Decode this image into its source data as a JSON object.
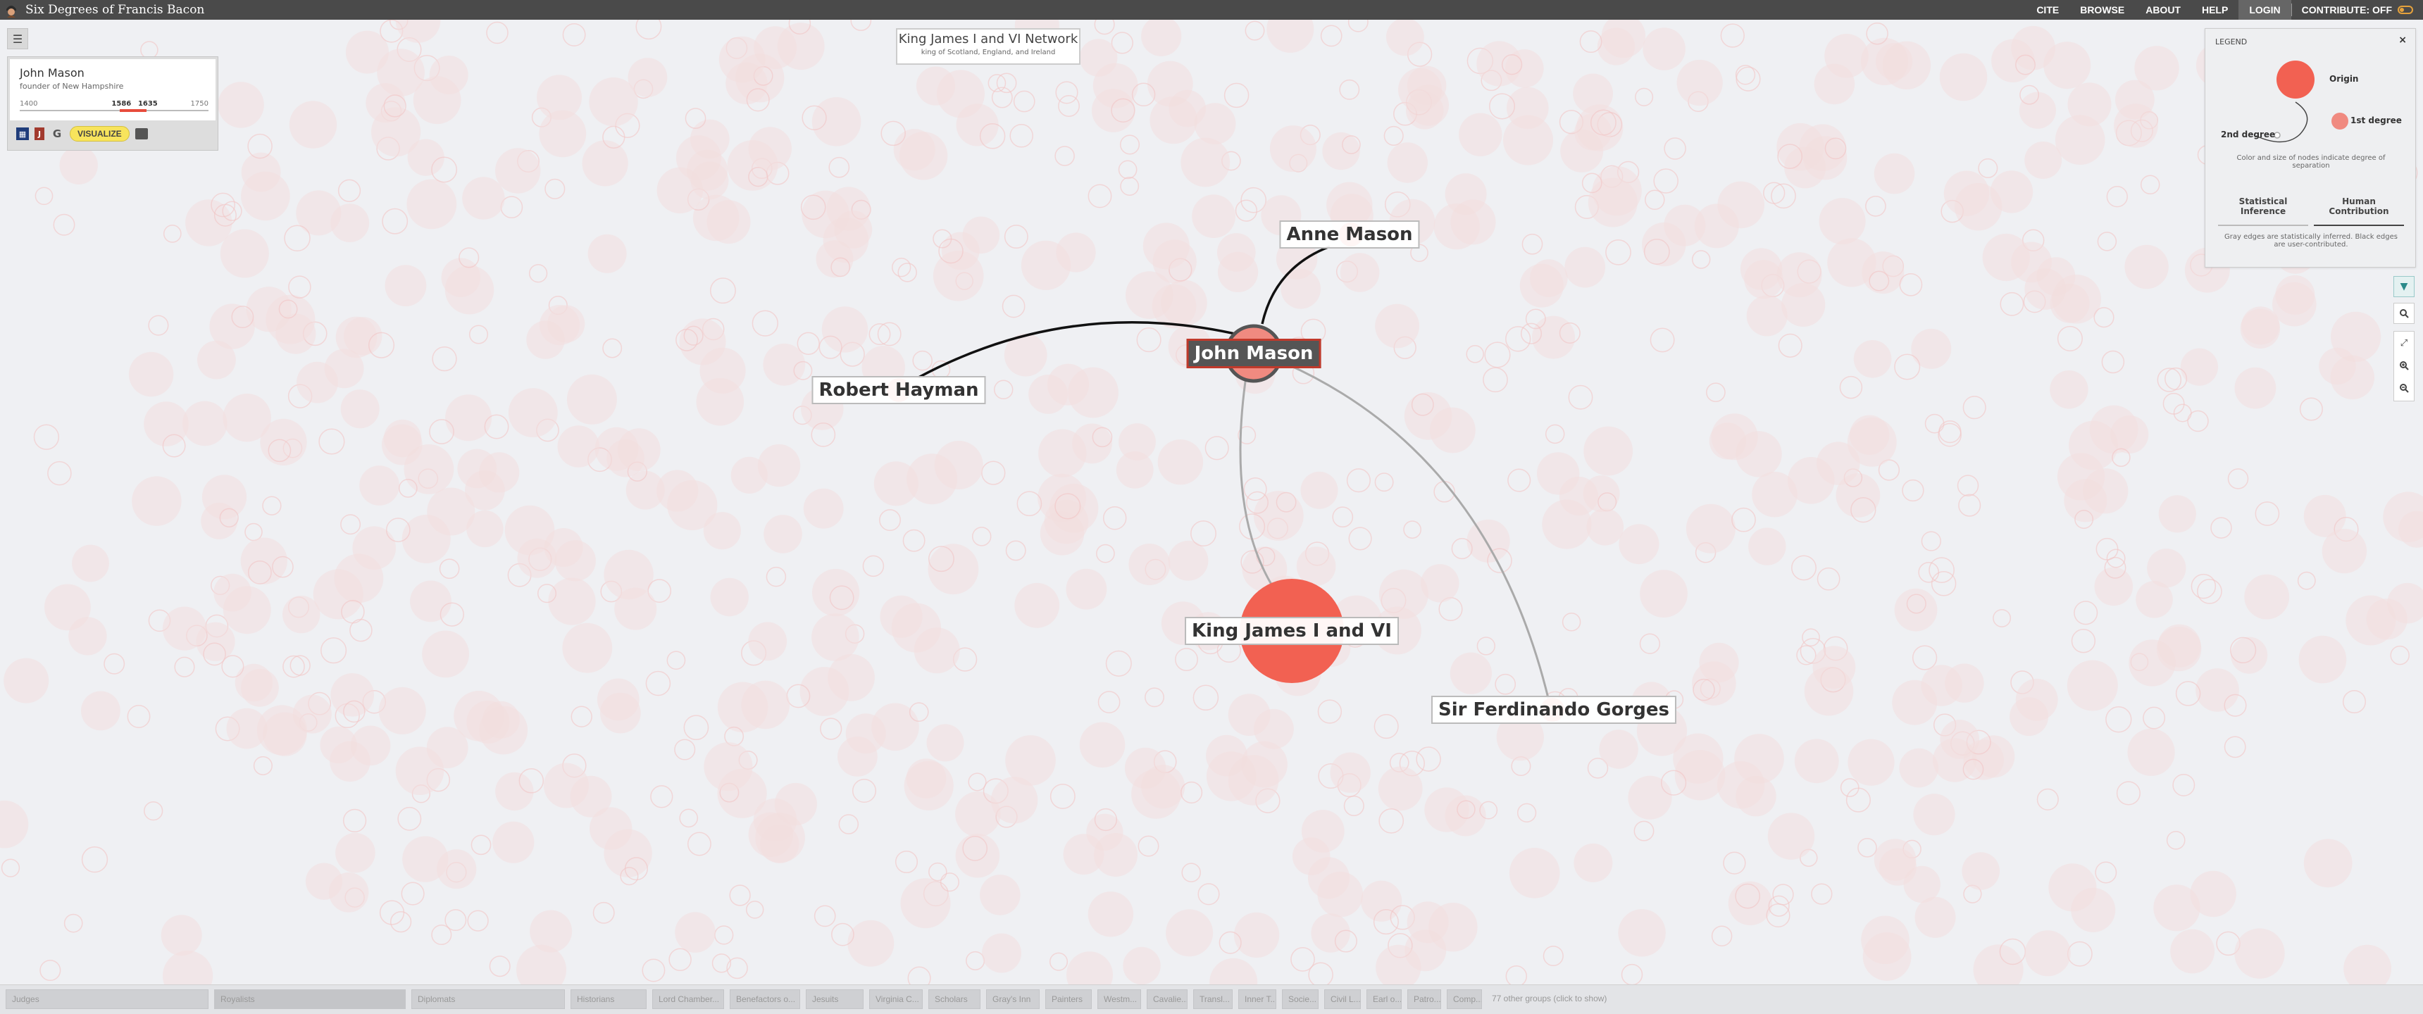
{
  "app": {
    "title": "Six Degrees of Francis Bacon"
  },
  "nav": {
    "cite": "CITE",
    "browse": "BROWSE",
    "about": "ABOUT",
    "help": "HELP",
    "login": "LOGIN",
    "contribute": "CONTRIBUTE: OFF"
  },
  "network": {
    "title": "King James I and VI Network",
    "subtitle": "king of Scotland, England, and Ireland"
  },
  "person_card": {
    "name": "John Mason",
    "description": "founder of New Hampshire",
    "timeline": {
      "min": "1400",
      "start": "1586",
      "end": "1635",
      "max": "1750",
      "min_value": 1400,
      "max_value": 1750,
      "start_value": 1586,
      "end_value": 1635
    },
    "visualize_label": "VISUALIZE",
    "sources": [
      "odnb-icon",
      "jstor-icon",
      "google-icon",
      "book-icon"
    ]
  },
  "graph": {
    "nodes": [
      {
        "id": "john-mason",
        "label": "John Mason",
        "role": "origin"
      },
      {
        "id": "anne-mason",
        "label": "Anne Mason",
        "role": "first-degree"
      },
      {
        "id": "robert-hayman",
        "label": "Robert Hayman",
        "role": "first-degree"
      },
      {
        "id": "king-james",
        "label": "King James I and VI",
        "role": "first-degree"
      },
      {
        "id": "ferdinando-gorges",
        "label": "Sir Ferdinando Gorges",
        "role": "first-degree"
      }
    ],
    "edges": [
      {
        "from": "john-mason",
        "to": "anne-mason",
        "type": "human"
      },
      {
        "from": "john-mason",
        "to": "robert-hayman",
        "type": "human"
      },
      {
        "from": "john-mason",
        "to": "king-james",
        "type": "statistical"
      },
      {
        "from": "john-mason",
        "to": "ferdinando-gorges",
        "type": "statistical"
      }
    ],
    "colors": {
      "node": "#f26152",
      "node_faint": "#f3dede",
      "background": "#eff0f3",
      "human_edge": "#111111",
      "statistical_edge": "#aaaaaa"
    }
  },
  "legend": {
    "title": "LEGEND",
    "close": "×",
    "origin": "Origin",
    "first_degree": "1st degree",
    "second_degree": "2nd degree",
    "note": "Color and size of nodes indicate degree of separation",
    "tabs": [
      "Statistical Inference",
      "Human Contribution"
    ],
    "footer": "Gray edges are statistically inferred. Black edges are user-contributed."
  },
  "tools": [
    "filter-icon",
    "search-icon",
    "expand-icon",
    "zoom-in-icon",
    "zoom-out-icon"
  ],
  "groups": {
    "items": [
      "Judges",
      "Royalists",
      "Diplomats",
      "Historians",
      "Lord Chamber...",
      "Benefactors o...",
      "Jesuits",
      "Virginia C...",
      "Scholars",
      "Gray's Inn",
      "Painters",
      "Westm...",
      "Cavalie...",
      "Transl...",
      "Inner T...",
      "Socie...",
      "Civil L...",
      "Earl o...",
      "Patro...",
      "Comp..."
    ],
    "more": "77 other groups (click to show)"
  }
}
